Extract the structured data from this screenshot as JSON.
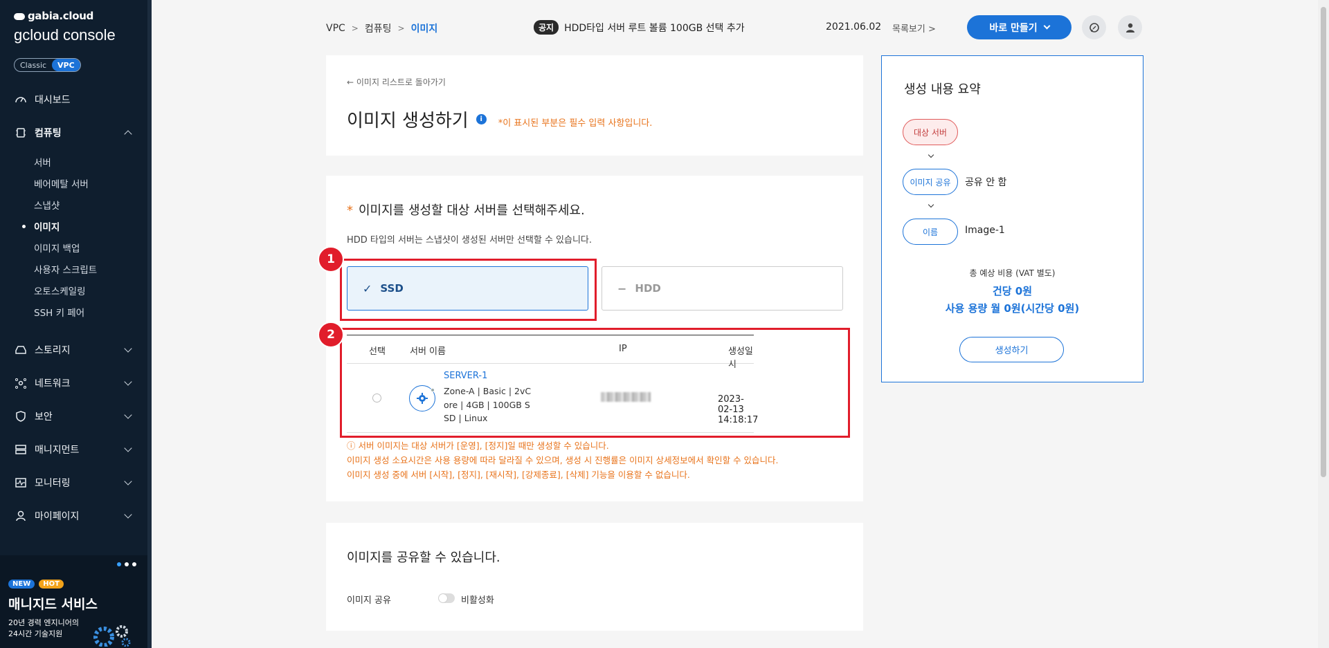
{
  "sidebar": {
    "brand_top": "gabia.cloud",
    "brand_bottom": "gcloud console",
    "toggle": [
      "Classic",
      "VPC"
    ],
    "items": [
      {
        "label": "대시보드"
      },
      {
        "label": "컴퓨팅",
        "sub": [
          "서버",
          "베어메탈 서버",
          "스냅샷",
          "이미지",
          "이미지 백업",
          "사용자 스크립트",
          "오토스케일링",
          "SSH 키 페어"
        ]
      },
      {
        "label": "스토리지"
      },
      {
        "label": "네트워크"
      },
      {
        "label": "보안"
      },
      {
        "label": "매니지먼트"
      },
      {
        "label": "모니터링"
      },
      {
        "label": "마이페이지"
      }
    ],
    "promo": {
      "badge_new": "NEW",
      "badge_hot": "HOT",
      "title": "매니지드 서비스",
      "desc_line1": "20년 경력 엔지니어의",
      "desc_line2": "24시간 기술지원"
    }
  },
  "header": {
    "breadcrumb": [
      "VPC",
      "컴퓨팅",
      "이미지"
    ],
    "notice_tag": "공지",
    "notice_text": "HDD타입 서버 루트 볼륨 100GB 선택 추가",
    "notice_date": "2021.06.02",
    "notice_more": "목록보기",
    "create_button": "바로 만들기"
  },
  "title_card": {
    "back": "이미지 리스트로 돌아가기",
    "title": "이미지 생성하기",
    "required_note": "*이 표시된 부분은 필수 입력 사항입니다."
  },
  "server_select": {
    "star": "*",
    "title": "이미지를 생성할 대상 서버를 선택해주세요.",
    "desc": "HDD 타입의 서버는 스냅샷이 생성된 서버만 선택할 수 있습니다.",
    "types": [
      {
        "label": "SSD",
        "selected": true
      },
      {
        "label": "HDD",
        "selected": false
      }
    ],
    "annotation_1": "1",
    "annotation_2": "2",
    "columns": [
      "선택",
      "서버 이름",
      "IP",
      "생성일시"
    ],
    "rows": [
      {
        "name": "SERVER-1",
        "spec_line1": "Zone-A  |  Basic  |  2vC",
        "spec_line2": "ore  |  4GB  |  100GB S",
        "spec_line3": "SD  |  Linux",
        "created": "2023-02-13 14:18:17"
      }
    ],
    "warnings": [
      "ⓘ 서버 이미지는 대상 서버가 [운영], [정지]일 때만 생성할 수 있습니다.",
      "이미지 생성 소요시간은 사용 용량에 따라 달라질 수 있으며, 생성 시 진행률은 이미지 상세정보에서 확인할 수 있습니다.",
      "이미지 생성 중에 서버 [시작], [정지], [재시작], [강제종료], [삭제] 기능을 이용할 수 없습니다."
    ]
  },
  "share": {
    "title": "이미지를 공유할 수 있습니다.",
    "label": "이미지 공유",
    "state": "비활성화"
  },
  "summary": {
    "title": "생성 내용 요약",
    "steps": [
      {
        "label": "대상 서버",
        "value": ""
      },
      {
        "label": "이미지 공유",
        "value": "공유 안 함"
      },
      {
        "label": "이름",
        "value": "Image-1"
      }
    ],
    "cost_label": "총 예상 비용 (VAT 별도)",
    "cost_per": "건당 0원",
    "cost_month": "사용 용량 월 0원(시간당 0원)",
    "button": "생성하기"
  },
  "colors": {
    "accent": "#1c73d8",
    "warning": "#e8731b",
    "annotation": "#e11d2b",
    "sidebar": "#0f1e2e"
  }
}
